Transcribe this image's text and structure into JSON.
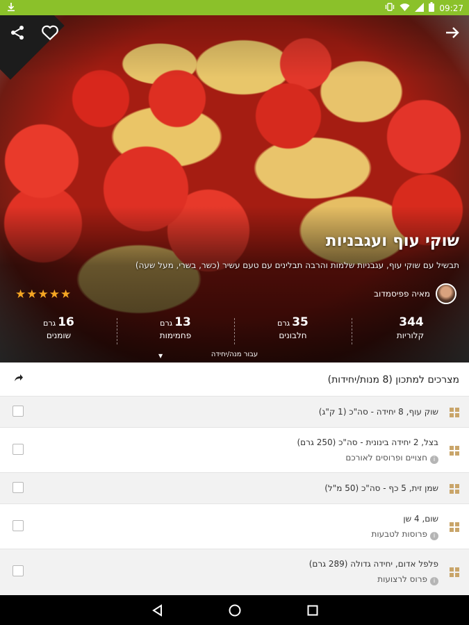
{
  "status_bar": {
    "time": "09:27"
  },
  "recipe": {
    "title": "שוקי עוף ועגבניות",
    "subtitle": "תבשיל עם שוקי עוף, עגבניות שלמות והרבה תבלינים עם טעם עשיר (כשר, בשרי, מעל שעה)",
    "author": "מאיה פפיסמדוב",
    "rating": 5,
    "stars": "★★★★★",
    "serving_label": "עבור מנה/יחידה"
  },
  "nutrition": [
    {
      "value": "344",
      "unit": "",
      "label": "קלוריות"
    },
    {
      "value": "35",
      "unit": "גרם",
      "label": "חלבונים"
    },
    {
      "value": "13",
      "unit": "גרם",
      "label": "פחמימות"
    },
    {
      "value": "16",
      "unit": "גרם",
      "label": "שומנים"
    }
  ],
  "ingredients": {
    "header": "מצרכים למתכון (8 מנות/יחידות)",
    "items": [
      {
        "text": "שוק עוף, 8 יחידה - סה\"כ (1 ק\"ג)",
        "note": ""
      },
      {
        "text": "בצל, 2 יחידה בינונית - סה\"כ (250 גרם)",
        "note": "חצויים ופרוסים לאורכם"
      },
      {
        "text": "שמן זית, 5 כף - סה\"כ (50 מ\"ל)",
        "note": ""
      },
      {
        "text": "שום, 4 שן",
        "note": "פרוסות לטבעות"
      },
      {
        "text": "פלפל אדום, יחידה גדולה (289 גרם)",
        "note": "פרוס לרצועות"
      }
    ]
  },
  "colors": {
    "status_bar": "#8bc12a",
    "stars": "#f5a623",
    "grip": "#c9a56a"
  },
  "icons": [
    "download-icon",
    "vibrate-icon",
    "wifi-icon",
    "signal-icon",
    "battery-icon",
    "share-icon",
    "heart-icon",
    "arrow-forward-icon",
    "info-icon",
    "back-icon",
    "home-icon",
    "recents-icon"
  ]
}
